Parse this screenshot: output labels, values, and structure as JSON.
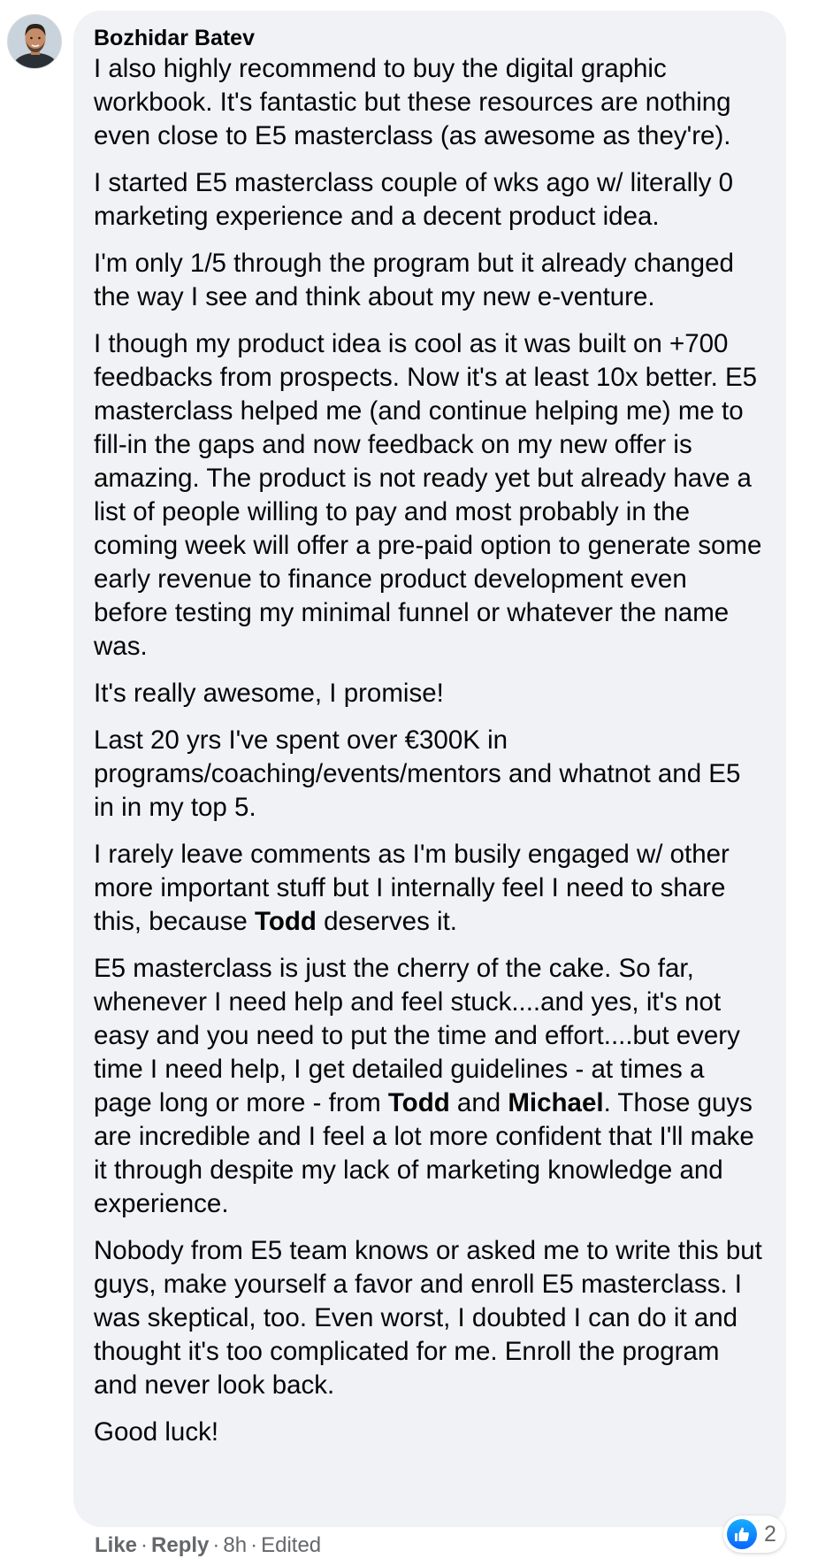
{
  "comment": {
    "author": "Bozhidar Batev",
    "paragraphs": [
      [
        "I also highly recommend to buy the digital graphic workbook. It's fantastic but these resources are nothing even close to E5 masterclass (as awesome as they're)."
      ],
      [
        "I started E5 masterclass couple of wks ago w/ literally 0 marketing experience and a decent product idea."
      ],
      [
        "I'm only 1/5 through the program but it already changed the way I see and think about my new e-venture."
      ],
      [
        "I though my product idea is cool as it was built on +700 feedbacks from prospects. Now it's at least 10x better. E5 masterclass helped me (and continue helping me) me to fill-in the gaps and now feedback on my new offer is amazing. The product is not ready yet but already have a list of people willing to pay and most probably in the coming week will offer a pre-paid option to generate some early revenue to finance product development even before testing my minimal funnel or whatever the name was."
      ],
      [
        "It's really awesome, I promise!"
      ],
      [
        "Last 20 yrs I've spent over €300K in programs/coaching/events/mentors and whatnot and E5 in in my top 5."
      ],
      [
        "I rarely leave comments as I'm busily engaged w/ other more important stuff but I internally feel I need to share this, because ",
        "Todd",
        " deserves it."
      ],
      [
        "E5 masterclass is just the cherry of the cake. So far, whenever I need help and feel stuck....and yes, it's not easy and you need to put the time and effort....but every time I need help, I get detailed guidelines - at times a page long or more - from ",
        "Todd",
        " and ",
        "Michael",
        ". Those guys are incredible and I feel a lot more confident that I'll make it through despite my lack of marketing knowledge and experience."
      ],
      [
        "Nobody from E5 team knows or asked me to write this but guys, make yourself a favor and enroll E5 masterclass. I was skeptical, too. Even worst, I doubted I can do it and thought it's too complicated for me. Enroll the program and never look back."
      ],
      [
        "Good luck!"
      ]
    ]
  },
  "reactions": {
    "icon": "like-icon",
    "count": "2",
    "color": "#0866ff"
  },
  "actions": {
    "like": "Like",
    "reply": "Reply",
    "separator": "·",
    "time": "8h",
    "edited": "Edited"
  }
}
